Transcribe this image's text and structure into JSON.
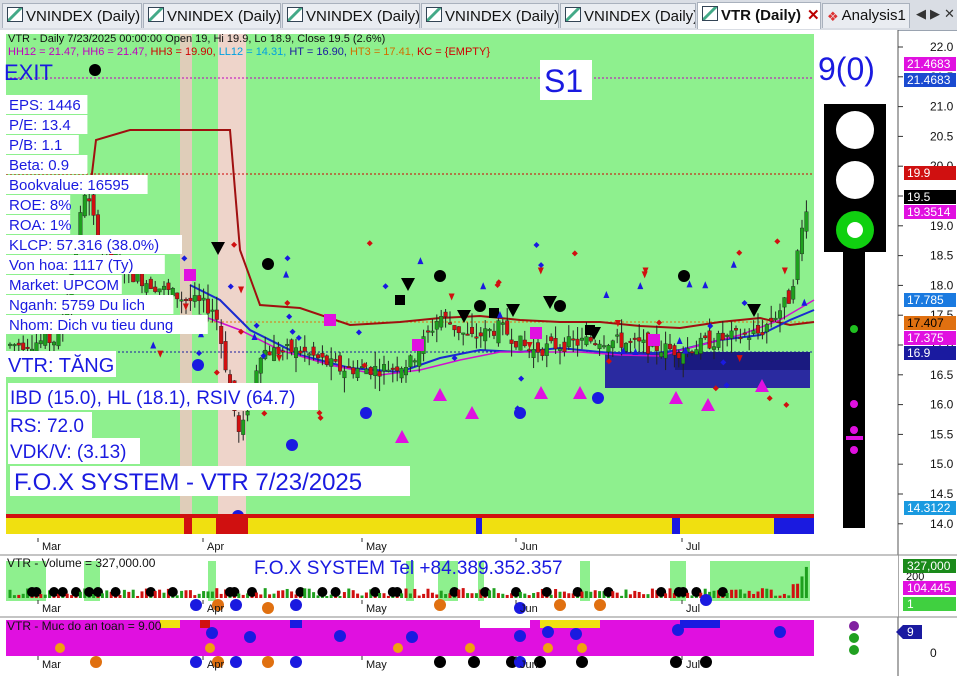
{
  "tabs": [
    {
      "label": "VNINDEX (Daily)",
      "active": false
    },
    {
      "label": "VNINDEX (Daily)",
      "active": false
    },
    {
      "label": "VNINDEX (Daily)",
      "active": false
    },
    {
      "label": "VNINDEX (Daily)",
      "active": false
    },
    {
      "label": "VNINDEX (Daily)",
      "active": false
    },
    {
      "label": "VTR (Daily)",
      "active": true
    },
    {
      "label": "Analysis1",
      "active": false
    }
  ],
  "header": {
    "line1": "VTR - Daily 7/23/2025 00:00:00 Open 19, Hi 19.9, Lo 18.9, Close 19.5 (2.6%)",
    "line2": [
      {
        "text": "HH12 = 21.47, ",
        "color": "#c000c0"
      },
      {
        "text": "HH6 = 21.47, ",
        "color": "#c000c0"
      },
      {
        "text": "HH3 = 19.90, ",
        "color": "#d00000"
      },
      {
        "text": "LL12 = 14.31, ",
        "color": "#00a0e0"
      },
      {
        "text": "HT = 16.90, ",
        "color": "#1a1aa0"
      },
      {
        "text": "HT3 = 17.41, ",
        "color": "#d07000"
      },
      {
        "text": "KC = {EMPTY}",
        "color": "#d00000"
      }
    ]
  },
  "overlay": {
    "exit_label": "EXIT",
    "signal": "S1",
    "counter": "9(0)",
    "fundamentals": [
      "EPS: 1446",
      "P/E: 13.4",
      "P/B: 1.1",
      "Beta: 0.9",
      "Bookvalue: 16595",
      "ROE: 8%",
      "ROA: 1%",
      "KLCP: 57.316 (38.0%)",
      "Von hoa: 1117 (Ty)",
      "Market: UPCOM",
      "Nganh: 5759 Du lich",
      "Nhom: Dich vu tieu dung"
    ],
    "trend": "VTR: TĂNG",
    "ibd": "IBD (15.0), HL (18.1), RSIV (64.7)",
    "rs": "RS: 72.0",
    "vdk": "VDK/V:  (3.13)",
    "system": "F.O.X SYSTEM - VTR 7/23/2025"
  },
  "price_axis": {
    "ticks": [
      "22.0",
      "21.5",
      "21.0",
      "20.5",
      "20.0",
      "19.5",
      "19.0",
      "18.5",
      "18.0",
      "17.5",
      "17.0",
      "16.5",
      "16.0",
      "15.5",
      "15.0",
      "14.5",
      "14.0"
    ],
    "labels": [
      {
        "text": "21.4683",
        "bg": "#e010e0",
        "fg": "#ffffff"
      },
      {
        "text": "21.4683",
        "bg": "#1a4ad0",
        "fg": "#ffffff"
      },
      {
        "text": "19.9",
        "bg": "#d01010",
        "fg": "#ffffff"
      },
      {
        "text": "19.5",
        "bg": "#000000",
        "fg": "#ffffff"
      },
      {
        "text": "19.3514",
        "bg": "#e010e0",
        "fg": "#ffffff"
      },
      {
        "text": "17.785",
        "bg": "#1a7ae0",
        "fg": "#ffffff"
      },
      {
        "text": "17.407",
        "bg": "#e07010",
        "fg": "#000000"
      },
      {
        "text": "17.375",
        "bg": "#e010e0",
        "fg": "#ffffff"
      },
      {
        "text": "16.9",
        "bg": "#1a1aa0",
        "fg": "#ffffff"
      },
      {
        "text": "14.3122",
        "bg": "#1a9ae0",
        "fg": "#ffffff"
      }
    ]
  },
  "months": [
    "Mar",
    "Apr",
    "May",
    "Jun",
    "Jul"
  ],
  "volume_panel": {
    "title": "VTR - Volume = 327,000.00",
    "contact": "F.O.X SYSTEM Tel +84.389.352.357",
    "axis": [
      "200",
      "100"
    ],
    "labels": [
      {
        "text": "327,000",
        "bg": "#1a8a1a",
        "fg": "#ffffff"
      },
      {
        "text": "104.445",
        "bg": "#e010e0",
        "fg": "#ffffff"
      },
      {
        "text": "1",
        "bg": "#40d040",
        "fg": "#ffffff"
      }
    ]
  },
  "safety_panel": {
    "title": "VTR - Muc do an toan = 9.00",
    "axis": [
      "0"
    ],
    "label": {
      "text": "9",
      "bg": "#1a1aa0",
      "fg": "#ffffff"
    }
  },
  "colors": {
    "chart_bg": "#8ef08e",
    "up": "#1ea01e",
    "down": "#d01010",
    "signal": "#1010d0",
    "magenta": "#e010e0"
  }
}
